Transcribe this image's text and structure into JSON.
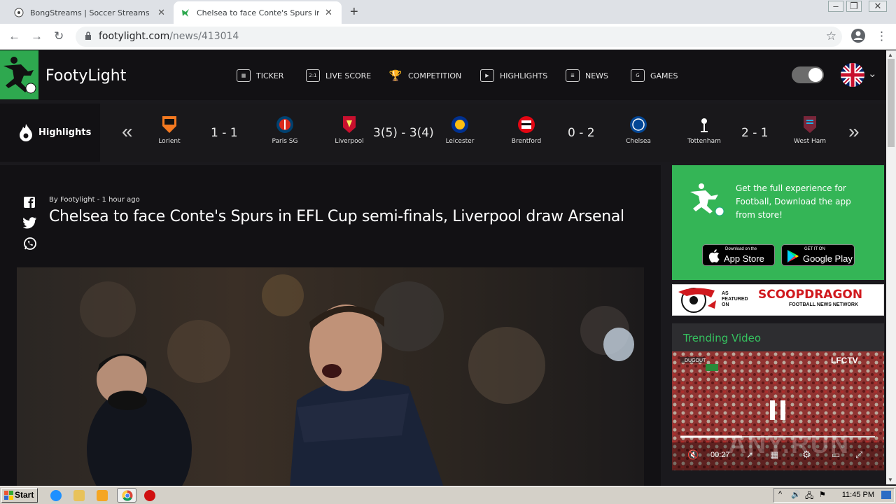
{
  "browser": {
    "tabs": [
      {
        "title": "BongStreams | Soccer Streams | NBA",
        "active": false
      },
      {
        "title": "Chelsea to face Conte's Spurs in EFL",
        "active": true
      }
    ],
    "url_host": "footylight.com",
    "url_path": "/news/413014"
  },
  "site": {
    "brand": "FootyLight",
    "nav": [
      {
        "label": "TICKER",
        "icon": "ticker-icon"
      },
      {
        "label": "LIVE SCORE",
        "icon": "livescore-icon",
        "icon_text": "2:1"
      },
      {
        "label": "COMPETITION",
        "icon": "trophy-icon"
      },
      {
        "label": "HIGHLIGHTS",
        "icon": "play-icon"
      },
      {
        "label": "NEWS",
        "icon": "news-icon"
      },
      {
        "label": "GAMES",
        "icon": "games-icon"
      }
    ]
  },
  "scores": {
    "section_label": "Highlights",
    "matches": [
      {
        "home": "Lorient",
        "away": "Paris SG",
        "score": "1 - 1"
      },
      {
        "home": "Liverpool",
        "away": "Leicester",
        "score": "3(5) - 3(4)"
      },
      {
        "home": "Brentford",
        "away": "Chelsea",
        "score": "0 - 2"
      },
      {
        "home": "Tottenham",
        "away": "West Ham",
        "score": "2 - 1"
      }
    ]
  },
  "article": {
    "byline": "By Footylight - 1 hour ago",
    "headline": "Chelsea to face Conte's Spurs in EFL Cup semi-finals, Liverpool draw Arsenal"
  },
  "sidebar": {
    "promo_text": "Get the full experience for Football, Download the app from store!",
    "appstore": {
      "small": "Download on the",
      "big": "App Store"
    },
    "googleplay": {
      "small": "GET IT ON",
      "big": "Google Play"
    },
    "scoop": {
      "small": "AS FEATURED ON",
      "big": "SCOOPDRAGON",
      "sub": "FOOTBALL NEWS NETWORK"
    },
    "trending_title": "Trending Video",
    "video": {
      "time": "00:27",
      "channel": "LFCTV",
      "watermark": "ANY.RUN"
    }
  },
  "taskbar": {
    "start": "Start",
    "clock": "11:45 PM"
  },
  "colors": {
    "brand_green": "#2ea84f",
    "trend_green": "#35c25f",
    "header_bg": "#121114"
  }
}
